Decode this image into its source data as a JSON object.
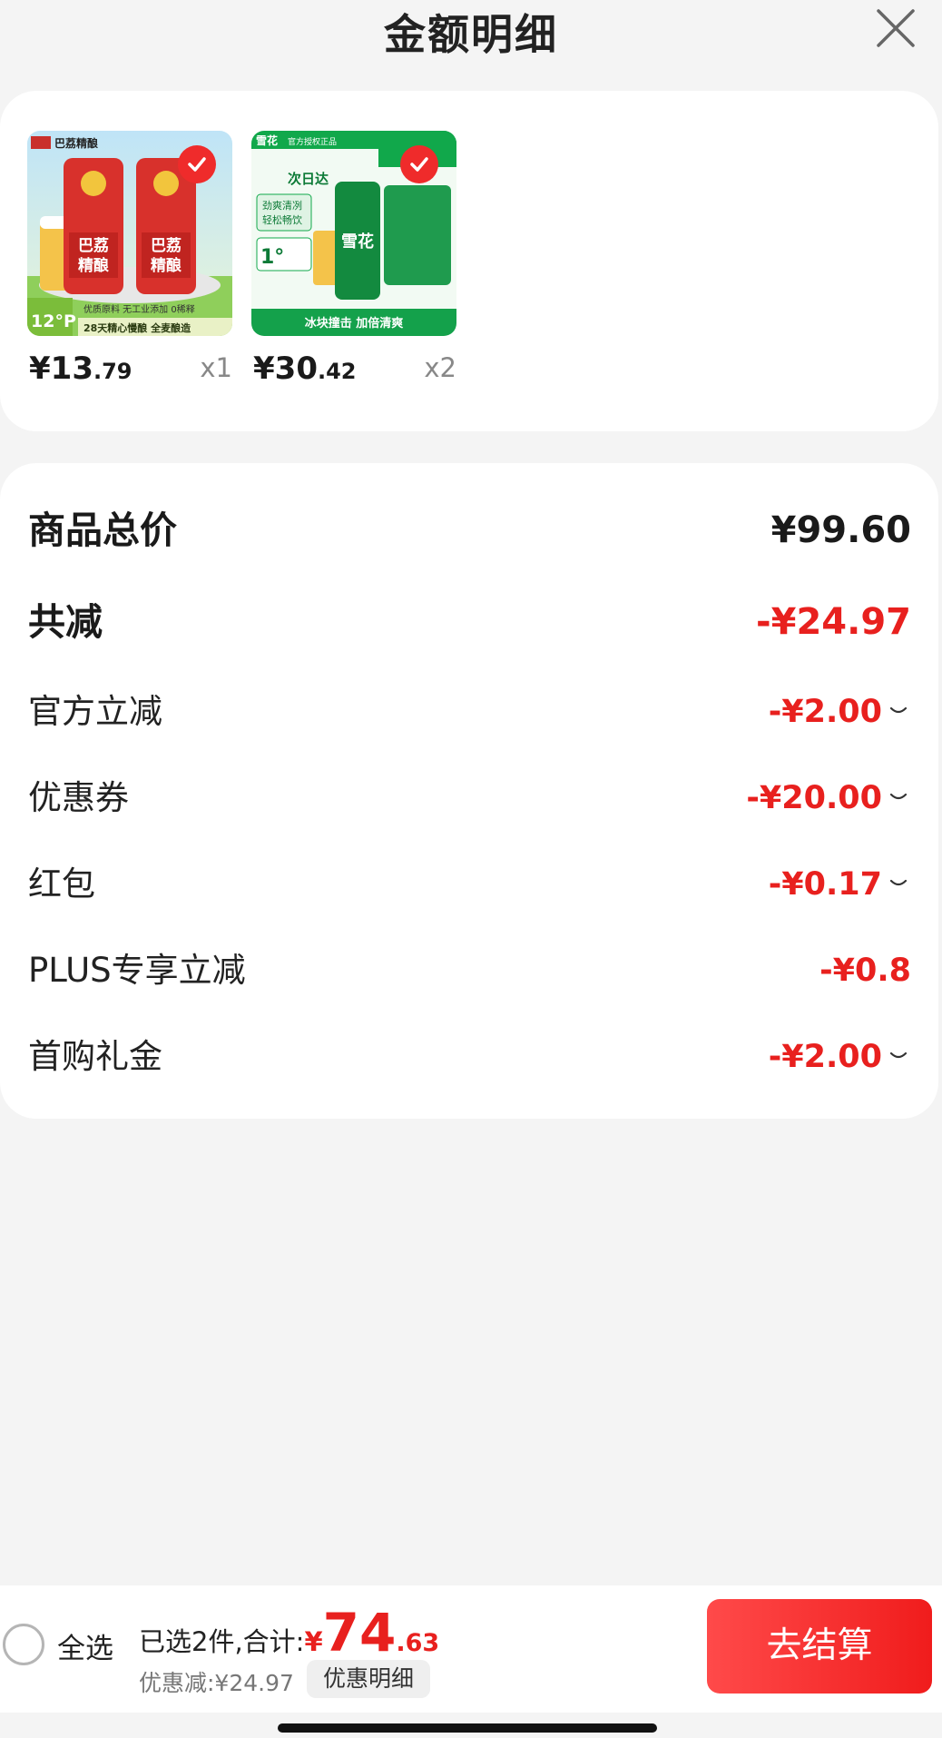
{
  "header": {
    "title": "金额明细"
  },
  "products": [
    {
      "image_lines": [
        "巴荔精酿",
        "巴荔",
        "精酿",
        "12°P",
        "优质原料 无工业添加 0稀释",
        "28天精心慢酿 全麦酿造"
      ],
      "price_int": "¥13",
      "price_dec": ".79",
      "qty": "x1"
    },
    {
      "image_lines": [
        "雪花",
        "官方授权正品",
        "次日达",
        "劲爽清冽",
        "轻松畅饮",
        "1°",
        "雪花",
        "冰块撞击 加倍清爽"
      ],
      "price_int": "¥30",
      "price_dec": ".42",
      "qty": "x2"
    }
  ],
  "summary": {
    "goods_total": {
      "label": "商品总价",
      "value": "¥99.60"
    },
    "total_reduce": {
      "label": "共减",
      "value": "-¥24.97"
    },
    "items": [
      {
        "label": "官方立减",
        "value": "-¥2.00"
      },
      {
        "label": "优惠券",
        "value": "-¥20.00"
      },
      {
        "label": "红包",
        "value": "-¥0.17"
      },
      {
        "label": "PLUS专享立减",
        "value": "-¥0.8"
      },
      {
        "label": "首购礼金",
        "value": "-¥2.00"
      }
    ]
  },
  "bottom": {
    "select_all": "全选",
    "selected_text": "已选2件,合计:",
    "currency": "¥",
    "total_int": "74",
    "total_dec": ".63",
    "discount_text": "优惠减:¥24.97",
    "detail_button": "优惠明细",
    "checkout_button": "去结算"
  },
  "colors": {
    "accent": "#e8201e",
    "checkout": "#f01c1c",
    "background": "#f4f4f4"
  }
}
